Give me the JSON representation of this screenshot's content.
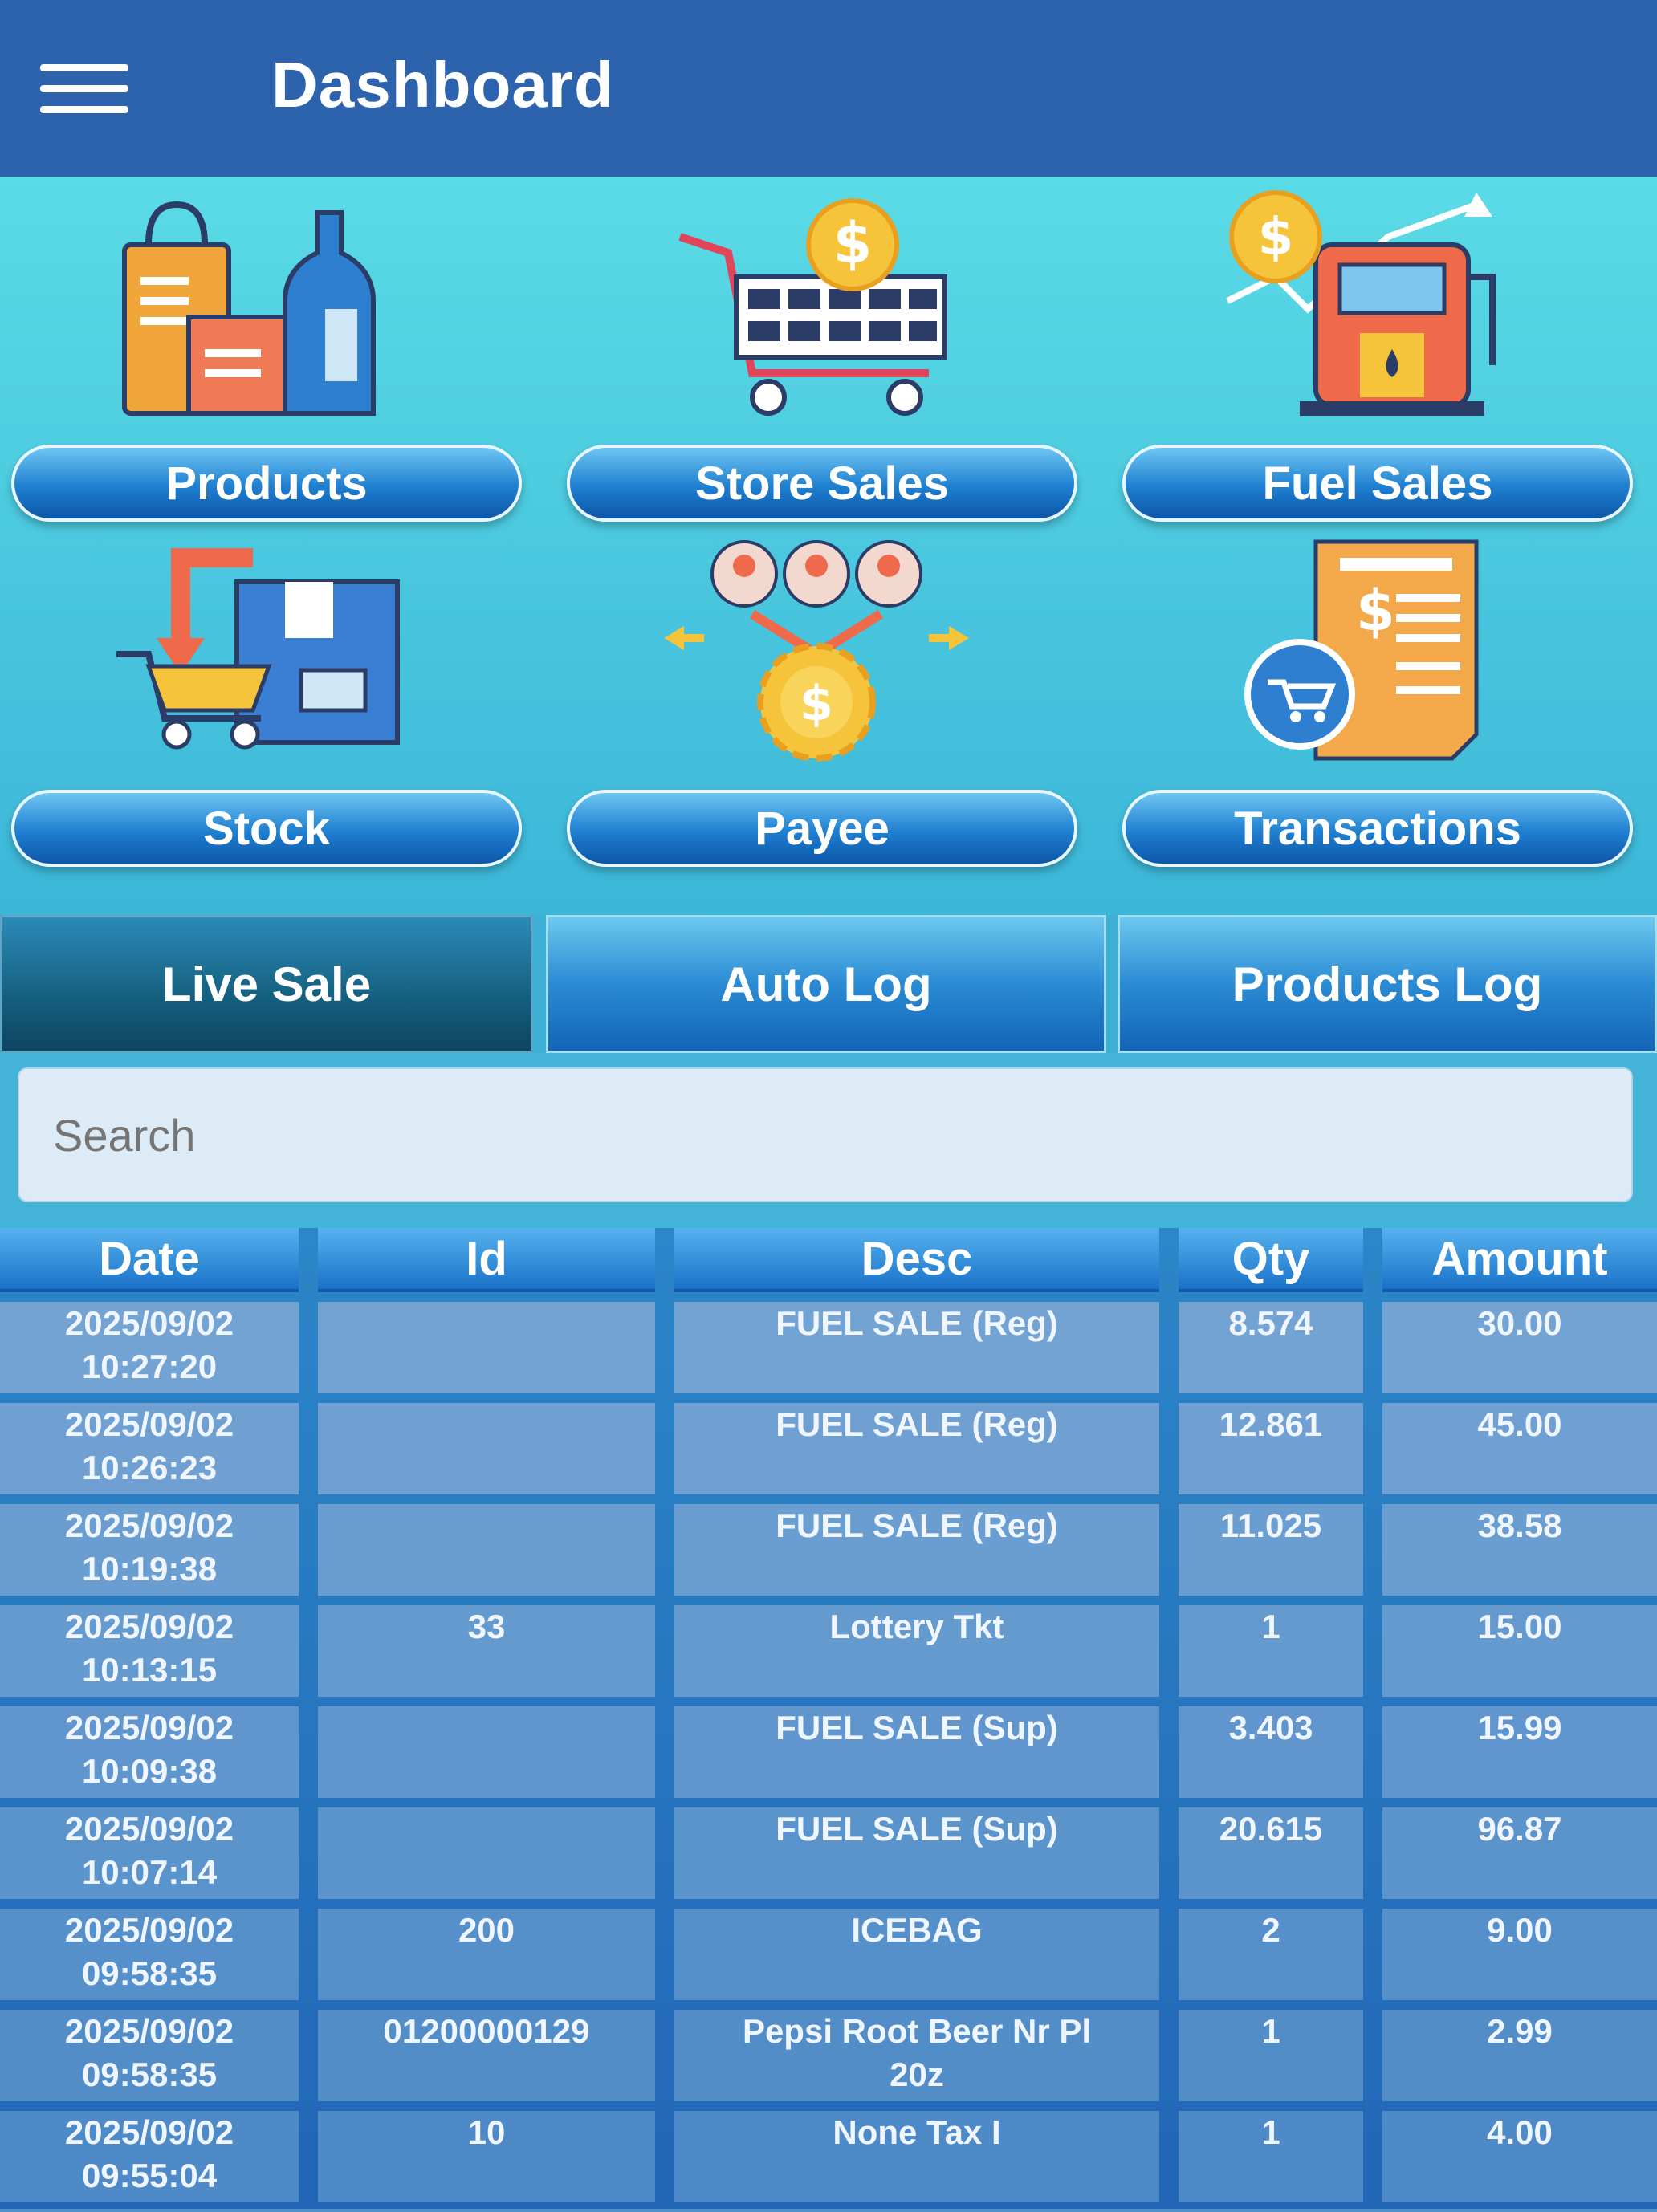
{
  "appbar": {
    "title": "Dashboard",
    "menu_icon": "hamburger-menu-icon"
  },
  "tiles": [
    {
      "label": "Products",
      "icon": "products-icon"
    },
    {
      "label": "Store Sales",
      "icon": "shopping-cart-icon"
    },
    {
      "label": "Fuel Sales",
      "icon": "fuel-pump-icon"
    },
    {
      "label": "Stock",
      "icon": "stock-icon"
    },
    {
      "label": "Payee",
      "icon": "payee-icon"
    },
    {
      "label": "Transactions",
      "icon": "receipt-icon"
    }
  ],
  "tabs": [
    {
      "label": "Live Sale",
      "active": true
    },
    {
      "label": "Auto Log",
      "active": false
    },
    {
      "label": "Products Log",
      "active": false
    }
  ],
  "search": {
    "placeholder": "Search",
    "value": ""
  },
  "table": {
    "headers": {
      "date": "Date",
      "id": "Id",
      "desc": "Desc",
      "qty": "Qty",
      "amount": "Amount"
    },
    "rows": [
      {
        "date": "2025/09/02",
        "time": "10:27:20",
        "id": "",
        "desc": "FUEL SALE (Reg)",
        "desc2": "",
        "qty": "8.574",
        "amount": "30.00"
      },
      {
        "date": "2025/09/02",
        "time": "10:26:23",
        "id": "",
        "desc": "FUEL SALE (Reg)",
        "desc2": "",
        "qty": "12.861",
        "amount": "45.00"
      },
      {
        "date": "2025/09/02",
        "time": "10:19:38",
        "id": "",
        "desc": "FUEL SALE (Reg)",
        "desc2": "",
        "qty": "11.025",
        "amount": "38.58"
      },
      {
        "date": "2025/09/02",
        "time": "10:13:15",
        "id": "33",
        "desc": "Lottery Tkt",
        "desc2": "",
        "qty": "1",
        "amount": "15.00"
      },
      {
        "date": "2025/09/02",
        "time": "10:09:38",
        "id": "",
        "desc": "FUEL SALE (Sup)",
        "desc2": "",
        "qty": "3.403",
        "amount": "15.99"
      },
      {
        "date": "2025/09/02",
        "time": "10:07:14",
        "id": "",
        "desc": "FUEL SALE (Sup)",
        "desc2": "",
        "qty": "20.615",
        "amount": "96.87"
      },
      {
        "date": "2025/09/02",
        "time": "09:58:35",
        "id": "200",
        "desc": "ICEBAG",
        "desc2": "",
        "qty": "2",
        "amount": "9.00"
      },
      {
        "date": "2025/09/02",
        "time": "09:58:35",
        "id": "01200000129",
        "desc": "Pepsi Root Beer Nr Pl",
        "desc2": "20z",
        "qty": "1",
        "amount": "2.99"
      },
      {
        "date": "2025/09/02",
        "time": "09:55:04",
        "id": "10",
        "desc": "None Tax I",
        "desc2": "",
        "qty": "1",
        "amount": "4.00"
      }
    ]
  },
  "colors": {
    "appbar": "#2d63ad",
    "tile_bg": "#5adbe6",
    "table_bg": "#2266b6"
  }
}
